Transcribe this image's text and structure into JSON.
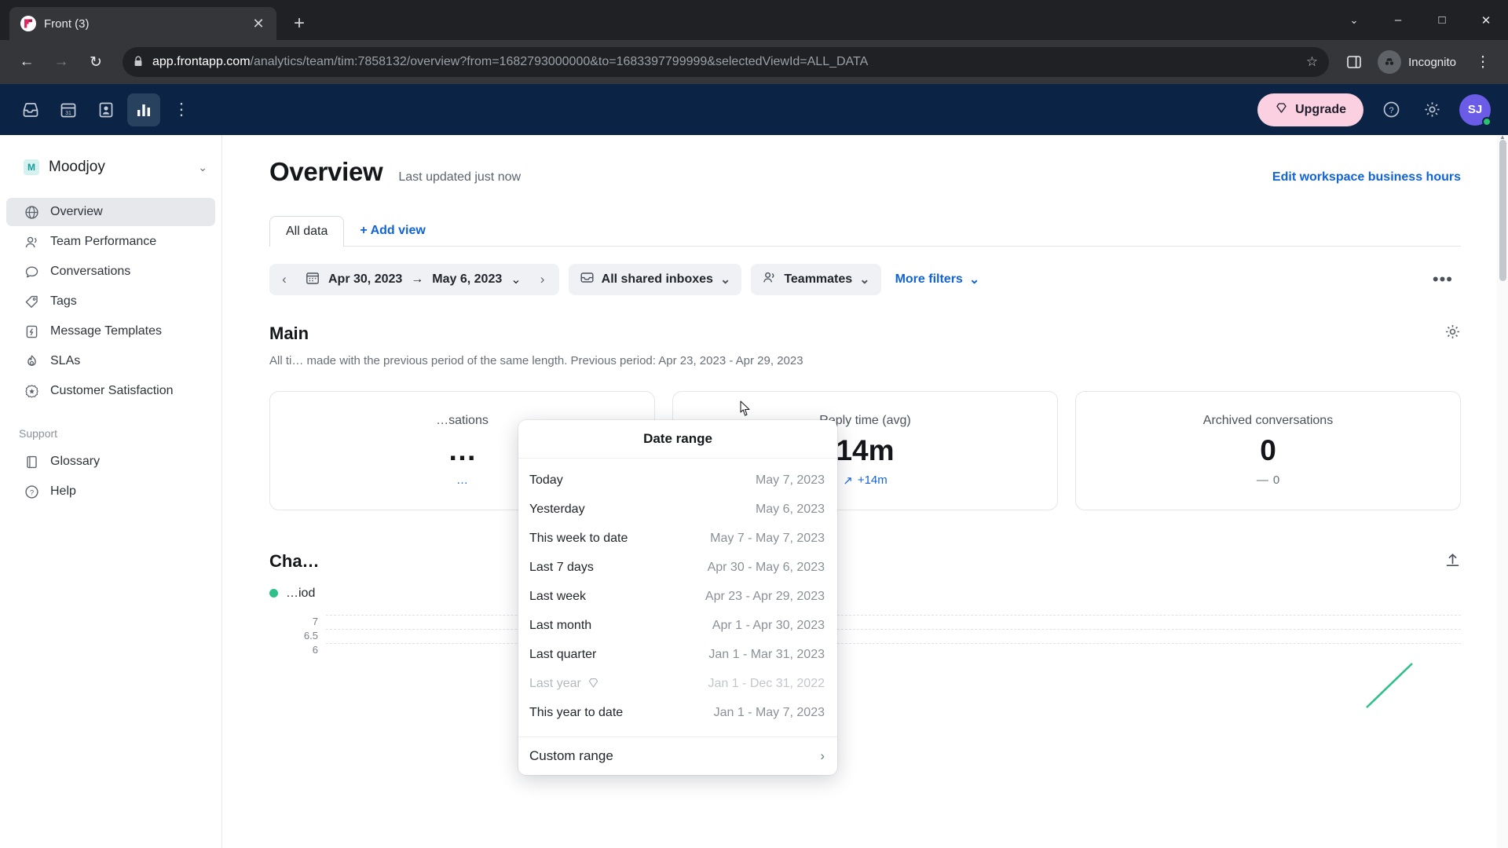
{
  "browser": {
    "tab": {
      "title": "Front (3)",
      "favicon": "front-logo-icon",
      "close": "✕"
    },
    "new_tab": "+",
    "window_controls": {
      "minimize": "–",
      "maximize": "□",
      "close": "✕",
      "caret": "⌄"
    },
    "nav": {
      "back": "←",
      "forward": "→",
      "reload": "↻"
    },
    "url": {
      "host": "app.frontapp.com",
      "path": "/analytics/team/tim:7858132/overview?from=1682793000000&to=1683397799999&selectedViewId=ALL_DATA",
      "lock_icon": "lock-icon",
      "star_icon": "☆"
    },
    "side_panel_icon": "side-panel-icon",
    "incognito_label": "Incognito",
    "menu_icon": "⋮"
  },
  "topbar": {
    "icons": [
      {
        "name": "inbox-icon",
        "glyph": "inbox"
      },
      {
        "name": "calendar-icon",
        "glyph": "31"
      },
      {
        "name": "contacts-icon",
        "glyph": "contact"
      },
      {
        "name": "analytics-icon",
        "glyph": "bars"
      },
      {
        "name": "more-icon",
        "glyph": "⋮"
      }
    ],
    "upgrade_label": "Upgrade",
    "upgrade_bg": "#fbd0e0",
    "help_icon": "?",
    "settings_icon": "gear-icon",
    "avatar_initials": "SJ",
    "avatar_bg": "#6b5ce7",
    "status_color": "#27c26b"
  },
  "sidebar": {
    "workspace": {
      "badge": "M",
      "name": "Moodjoy",
      "caret": "⌄"
    },
    "items": [
      {
        "label": "Overview",
        "icon": "globe-icon",
        "active": true
      },
      {
        "label": "Team Performance",
        "icon": "people-icon",
        "active": false
      },
      {
        "label": "Conversations",
        "icon": "chat-bubble-icon",
        "active": false
      },
      {
        "label": "Tags",
        "icon": "tag-icon",
        "active": false
      },
      {
        "label": "Message Templates",
        "icon": "template-icon",
        "active": false
      },
      {
        "label": "SLAs",
        "icon": "flame-icon",
        "active": false
      },
      {
        "label": "Customer Satisfaction",
        "icon": "star-badge-icon",
        "active": false
      }
    ],
    "support_header": "Support",
    "support_items": [
      {
        "label": "Glossary",
        "icon": "book-icon"
      },
      {
        "label": "Help",
        "icon": "help-circle-icon"
      }
    ]
  },
  "main": {
    "title": "Overview",
    "subtitle": "Last updated just now",
    "edit_hours_link": "Edit workspace business hours",
    "tabs": [
      {
        "label": "All data",
        "active": true
      }
    ],
    "add_view": "+ Add view",
    "filters": {
      "prev_arrow": "‹",
      "next_arrow": "›",
      "calendar_icon": "calendar-icon",
      "date_from": "Apr 30, 2023",
      "date_arrow": "→",
      "date_to": "May 6, 2023",
      "caret": "⌄",
      "inbox_chip": "All shared inboxes",
      "teammates_chip": "Teammates",
      "more_filters": "More filters",
      "overflow": "•••"
    },
    "section": {
      "title": "Main",
      "description": "All ti… made with the previous period of the same length. Previous period: Apr 23, 2023 - Apr 29, 2023",
      "gear_icon": "gear-icon"
    },
    "cards": [
      {
        "label": "…sations",
        "value": "…",
        "delta": "…",
        "delta_dir": "up",
        "hidden_by_popover": true
      },
      {
        "label": "Reply time (avg)",
        "value": "14m",
        "delta": "+14m",
        "delta_dir": "up",
        "delta_icon": "↗"
      },
      {
        "label": "Archived conversations",
        "value": "0",
        "delta": "0",
        "delta_dir": "flat",
        "delta_icon": "—"
      }
    ],
    "chart": {
      "title": "Cha…",
      "legend_label": "…iod",
      "legend_color": "#2fc08a",
      "upload_icon": "upload-icon"
    }
  },
  "chart_data": {
    "type": "line",
    "title": "Chart",
    "series": [
      {
        "name": "Current period",
        "color": "#2fc08a",
        "values": [
          null,
          null,
          null,
          null,
          6,
          7
        ]
      }
    ],
    "ytick_labels": [
      "7",
      "6.5",
      "6"
    ],
    "ylim": [
      6,
      7
    ],
    "grid": true,
    "legend_position": "top-left"
  },
  "popover": {
    "title": "Date range",
    "items": [
      {
        "label": "Today",
        "value": "May 7, 2023",
        "disabled": false
      },
      {
        "label": "Yesterday",
        "value": "May 6, 2023",
        "disabled": false
      },
      {
        "label": "This week to date",
        "value": "May 7 - May 7, 2023",
        "disabled": false
      },
      {
        "label": "Last 7 days",
        "value": "Apr 30 - May 6, 2023",
        "disabled": false
      },
      {
        "label": "Last week",
        "value": "Apr 23 - Apr 29, 2023",
        "disabled": false
      },
      {
        "label": "Last month",
        "value": "Apr 1 - Apr 30, 2023",
        "disabled": false
      },
      {
        "label": "Last quarter",
        "value": "Jan 1 - Mar 31, 2023",
        "disabled": false
      },
      {
        "label": "Last year",
        "value": "Jan 1 - Dec 31, 2022",
        "disabled": true,
        "badge": "⬡"
      },
      {
        "label": "This year to date",
        "value": "Jan 1 - May 7, 2023",
        "disabled": false
      }
    ],
    "custom": {
      "label": "Custom range",
      "chevron": "›"
    }
  }
}
